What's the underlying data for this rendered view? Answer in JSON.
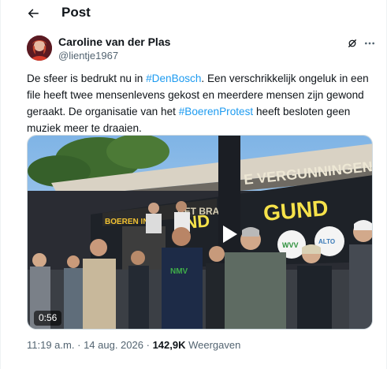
{
  "header": {
    "title": "Post"
  },
  "author": {
    "name": "Caroline van der Plas",
    "handle": "@lientje1967"
  },
  "tweet": {
    "part1": "De sfeer is bedrukt nu in ",
    "hashtag1": "#DenBosch",
    "part2": ". Een verschrikkelijk ongeluk in een file heeft twee mensenlevens gekost en meerdere mensen zijn gewond geraakt. De organisatie van het ",
    "hashtag2": "#BoerenProtest",
    "part3": " heeft besloten geen muziek meer te draaien."
  },
  "media": {
    "duration": "0:56",
    "banner_left": "BOEREN IN",
    "banner_middle": "HET BRABA",
    "banner_right": "E VERGUNNINGEN",
    "banner_yellow": "GUND",
    "banner_yellow_left": "ND",
    "badge_left": "WVV",
    "badge_right": "ALTO",
    "shirt_text": "NMV"
  },
  "meta": {
    "time": "11:19 a.m.",
    "separator": "·",
    "date": "14 aug. 2026",
    "views_count": "142,9K",
    "views_label": "Weergaven"
  },
  "colors": {
    "link": "#1d9bf0",
    "secondary": "#536471",
    "text": "#0f1419"
  }
}
